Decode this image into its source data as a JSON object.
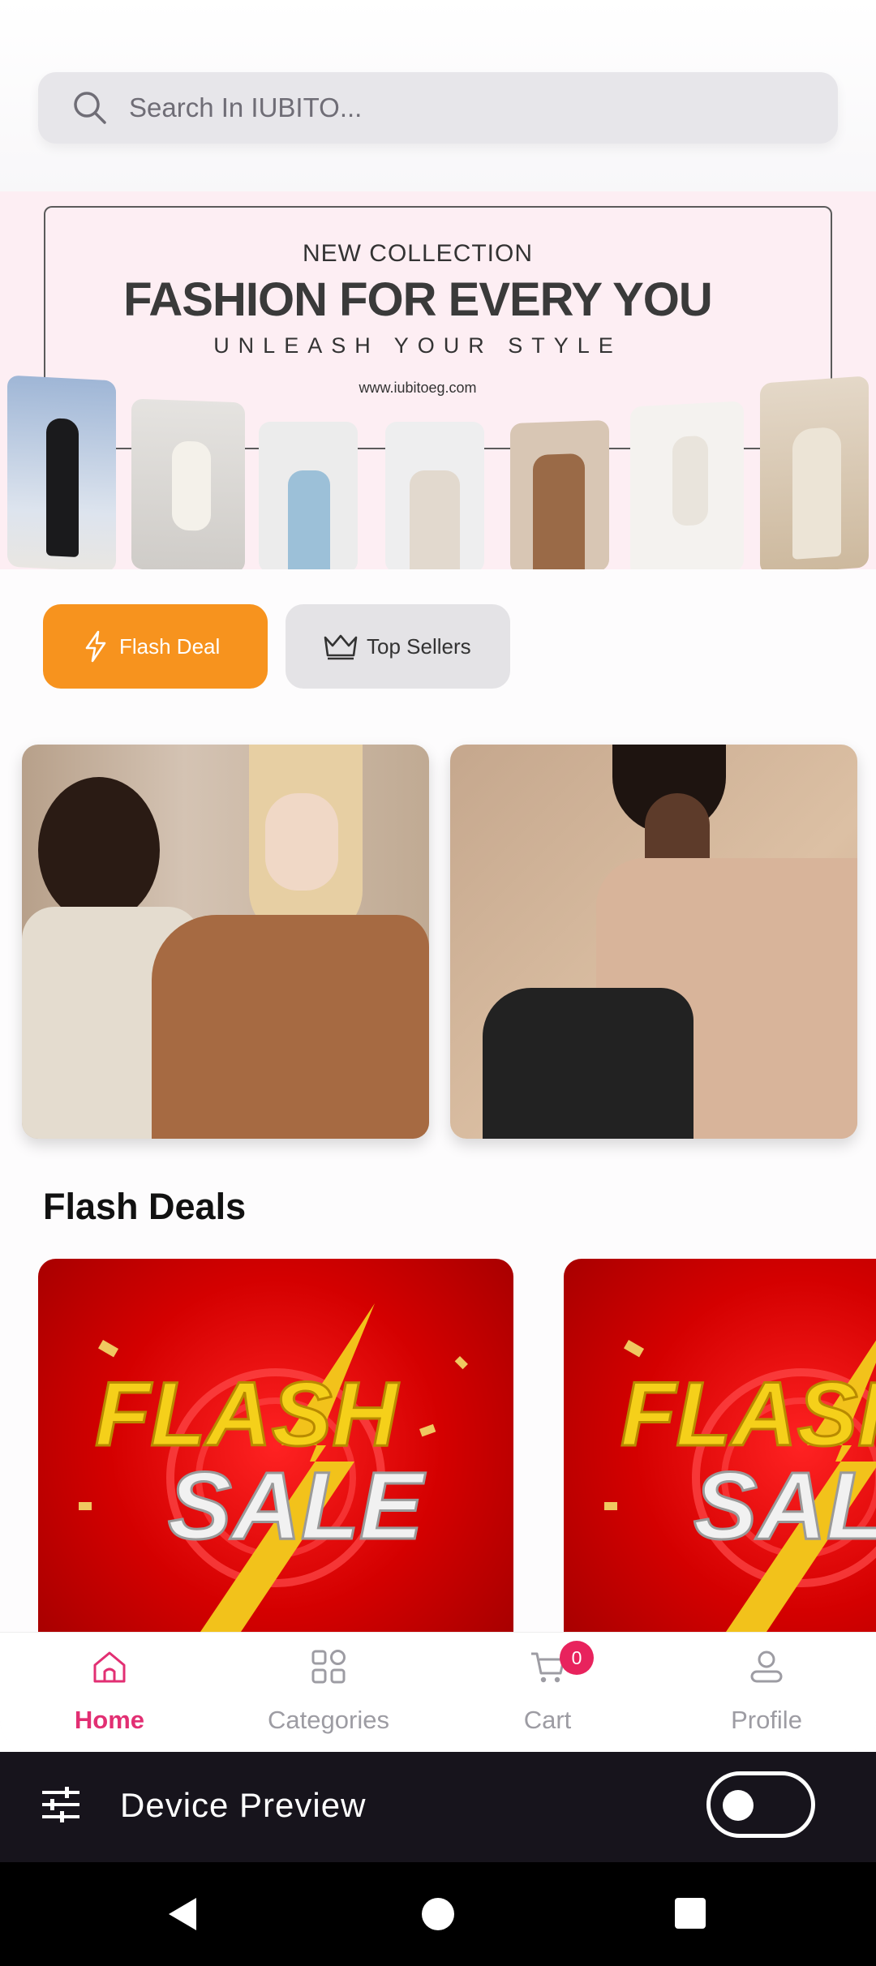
{
  "search": {
    "placeholder": "Search In IUBITO..."
  },
  "banner": {
    "kicker": "NEW COLLECTION",
    "title": "FASHION FOR EVERY YOU",
    "subtitle": "UNLEASH YOUR STYLE",
    "url": "www.iubitoeg.com"
  },
  "chips": {
    "flash_deal": "Flash Deal",
    "top_sellers": "Top Sellers"
  },
  "flash_deals": {
    "title": "Flash Deals",
    "card_word1": "FLASH",
    "card_word2": "SALE"
  },
  "bottom_nav": {
    "home": "Home",
    "categories": "Categories",
    "cart": "Cart",
    "cart_count": "0",
    "profile": "Profile",
    "active": "home",
    "active_color": "#e22f73"
  },
  "device_preview": {
    "label": "Device Preview",
    "enabled": false
  },
  "colors": {
    "flash_chip": "#f7931e",
    "accent": "#e22f73",
    "badge": "#e8235d"
  }
}
